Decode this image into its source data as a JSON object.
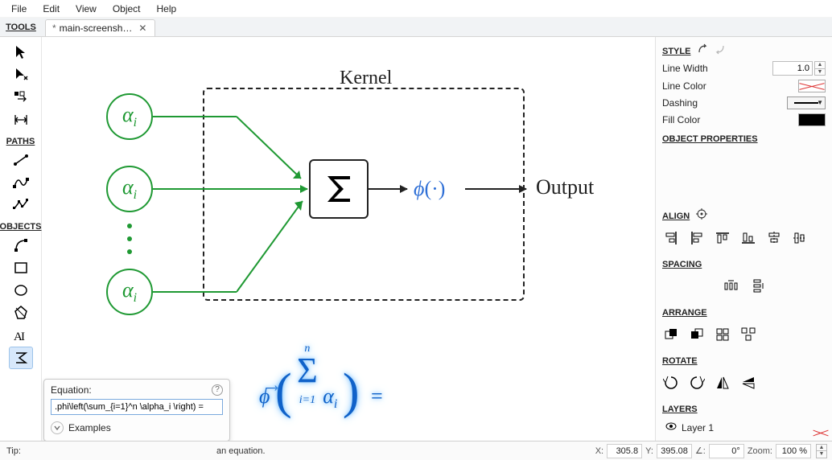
{
  "menu": {
    "items": [
      "File",
      "Edit",
      "View",
      "Object",
      "Help"
    ]
  },
  "tab": {
    "dirty_mark": "*",
    "title": "main-screensh…",
    "close_glyph": "✕"
  },
  "toolbar": {
    "title": "TOOLS",
    "paths_title": "PATHS",
    "objects_title": "OBJECTS"
  },
  "diagram": {
    "kernel_label": "Kernel",
    "alpha_label": "α",
    "alpha_sub": "i",
    "phi_label": "ϕ",
    "phi_arg": "(·)",
    "output_label": "Output"
  },
  "big_formula": {
    "text": "ϕ⃗ ( Σ_{i=1}^{n} α_i ) ="
  },
  "eq_popup": {
    "title": "Equation:",
    "value": ".phi\\left(\\sum_{i=1}^n \\alpha_i \\right) = ",
    "examples_label": "Examples"
  },
  "right": {
    "style_title": "STYLE",
    "line_width_label": "Line Width",
    "line_width_value": "1.0",
    "line_color_label": "Line Color",
    "dashing_label": "Dashing",
    "fill_color_label": "Fill Color",
    "object_props_title": "OBJECT PROPERTIES",
    "align_title": "ALIGN",
    "spacing_title": "SPACING",
    "arrange_title": "ARRANGE",
    "rotate_title": "ROTATE",
    "layers_title": "LAYERS",
    "layer0": "Layer 1"
  },
  "status": {
    "tip_label": "Tip:",
    "tip_text": "an equation.",
    "x_label": "X:",
    "x_val": "305.8",
    "y_label": "Y:",
    "y_val": "395.08",
    "angle_label": "∠:",
    "angle_val": "0°",
    "zoom_label": "Zoom:",
    "zoom_val": "100 %"
  },
  "colors": [
    "#f5c518",
    "#f08c00",
    "#d9480f",
    "#5c3a1a",
    "#103a6d",
    "#1c4f9c",
    "#2b6cb0",
    "#3f8ecb",
    "#6a3fa0",
    "#8a2b7a",
    "#b2245b",
    "#c92a2a",
    "#8a1d1d",
    "#4a0d0d"
  ],
  "grays": [
    "#ffffff",
    "#f2f2f2",
    "#e6e6e6",
    "#d9d9d9",
    "#cccccc",
    "#bfbfbf",
    "#b3b3b3",
    "#a6a6a6",
    "#999999",
    "#8c8c8c",
    "#808080",
    "#737373",
    "#666666",
    "#595959",
    "#4d4d4d",
    "#404040",
    "#333333",
    "#262626",
    "#1a1a1a",
    "#000000"
  ],
  "chart_data": {
    "type": "diagram",
    "title": "Kernel",
    "inputs": [
      {
        "label": "α_i"
      },
      {
        "label": "α_i"
      },
      {
        "ellipsis": true
      },
      {
        "label": "α_i"
      }
    ],
    "aggregator": {
      "op": "Σ"
    },
    "activation": {
      "label": "ϕ(·)"
    },
    "output": {
      "label": "Output"
    },
    "formula": "ϕ⃗(Σ_{i=1}^{n} α_i) =",
    "latex": "\\vec{\\phi}\\left(\\sum_{i=1}^{n} \\alpha_i \\right) ="
  }
}
